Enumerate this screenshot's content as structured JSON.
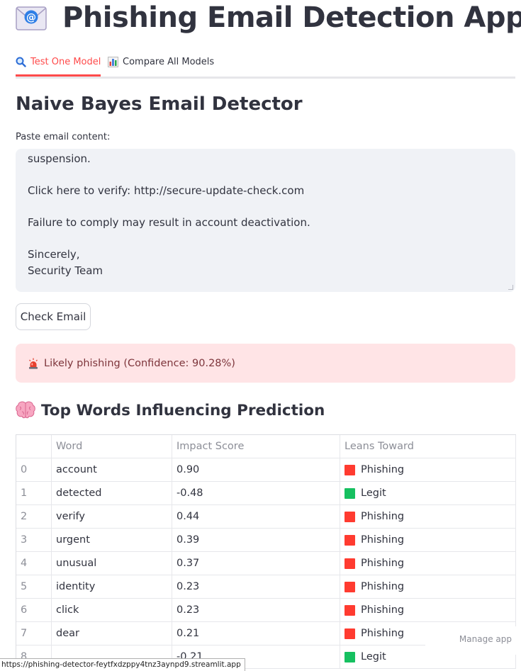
{
  "header": {
    "icon": "envelope-at-icon",
    "title": "Phishing Email Detection App"
  },
  "tabs": [
    {
      "label": "Test One Model",
      "icon": "magnifier-icon",
      "active": true
    },
    {
      "label": "Compare All Models",
      "icon": "bar-chart-icon",
      "active": false
    }
  ],
  "section_title": "Naive Bayes Email Detector",
  "email_input": {
    "label": "Paste email content:",
    "lines": [
      "suspension.",
      "",
      "Click here to verify: http://secure-update-check.com",
      "",
      "Failure to comply may result in account deactivation.",
      "",
      "Sincerely,",
      "Security Team"
    ]
  },
  "check_button": "Check Email",
  "alert": {
    "icon": "siren-icon",
    "text": "Likely phishing (Confidence: 90.28%)",
    "color": "#ffe4e6"
  },
  "words_section": {
    "icon": "brain-icon",
    "title": "Top Words Influencing Prediction"
  },
  "table": {
    "columns": [
      "",
      "Word",
      "Impact Score",
      "Leans Toward"
    ],
    "rows": [
      {
        "index": "0",
        "word": "account",
        "score": "0.90",
        "lean": "Phishing",
        "lean_color": "#ff3b30"
      },
      {
        "index": "1",
        "word": "detected",
        "score": "-0.48",
        "lean": "Legit",
        "lean_color": "#16c060"
      },
      {
        "index": "2",
        "word": "verify",
        "score": "0.44",
        "lean": "Phishing",
        "lean_color": "#ff3b30"
      },
      {
        "index": "3",
        "word": "urgent",
        "score": "0.39",
        "lean": "Phishing",
        "lean_color": "#ff3b30"
      },
      {
        "index": "4",
        "word": "unusual",
        "score": "0.37",
        "lean": "Phishing",
        "lean_color": "#ff3b30"
      },
      {
        "index": "5",
        "word": "identity",
        "score": "0.23",
        "lean": "Phishing",
        "lean_color": "#ff3b30"
      },
      {
        "index": "6",
        "word": "click",
        "score": "0.23",
        "lean": "Phishing",
        "lean_color": "#ff3b30"
      },
      {
        "index": "7",
        "word": "dear",
        "score": "0.21",
        "lean": "Phishing",
        "lean_color": "#ff3b30"
      },
      {
        "index": "8",
        "word": "",
        "score": "-0.21",
        "lean": "Legit",
        "lean_color": "#16c060"
      }
    ]
  },
  "manage_app": "Manage app",
  "status_url": "https://phishing-detector-feytfxdzppy4tnz3aynpd9.streamlit.app",
  "colors": {
    "accent": "#ff4b4b",
    "phishing": "#ff3b30",
    "legit": "#16c060"
  }
}
